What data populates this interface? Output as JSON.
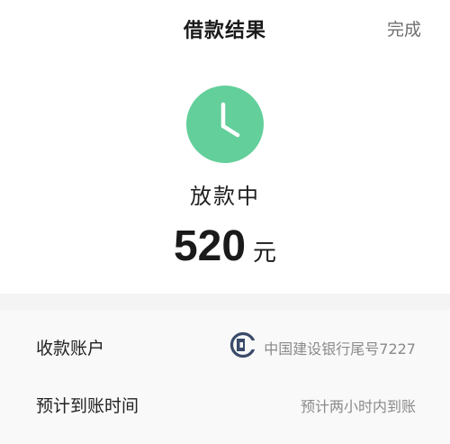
{
  "header": {
    "title": "借款结果",
    "done_label": "完成"
  },
  "status": {
    "icon": "clock-icon",
    "text": "放款中",
    "amount": "520",
    "unit": "元"
  },
  "details": [
    {
      "label": "收款账户",
      "value": "中国建设银行尾号7227",
      "icon": "ccb-bank-logo-icon"
    },
    {
      "label": "预计到账时间",
      "value": "预计两小时内到账"
    }
  ],
  "colors": {
    "status_green": "#63cf9b",
    "background": "#ffffff",
    "card_background": "#f9f9f9"
  }
}
